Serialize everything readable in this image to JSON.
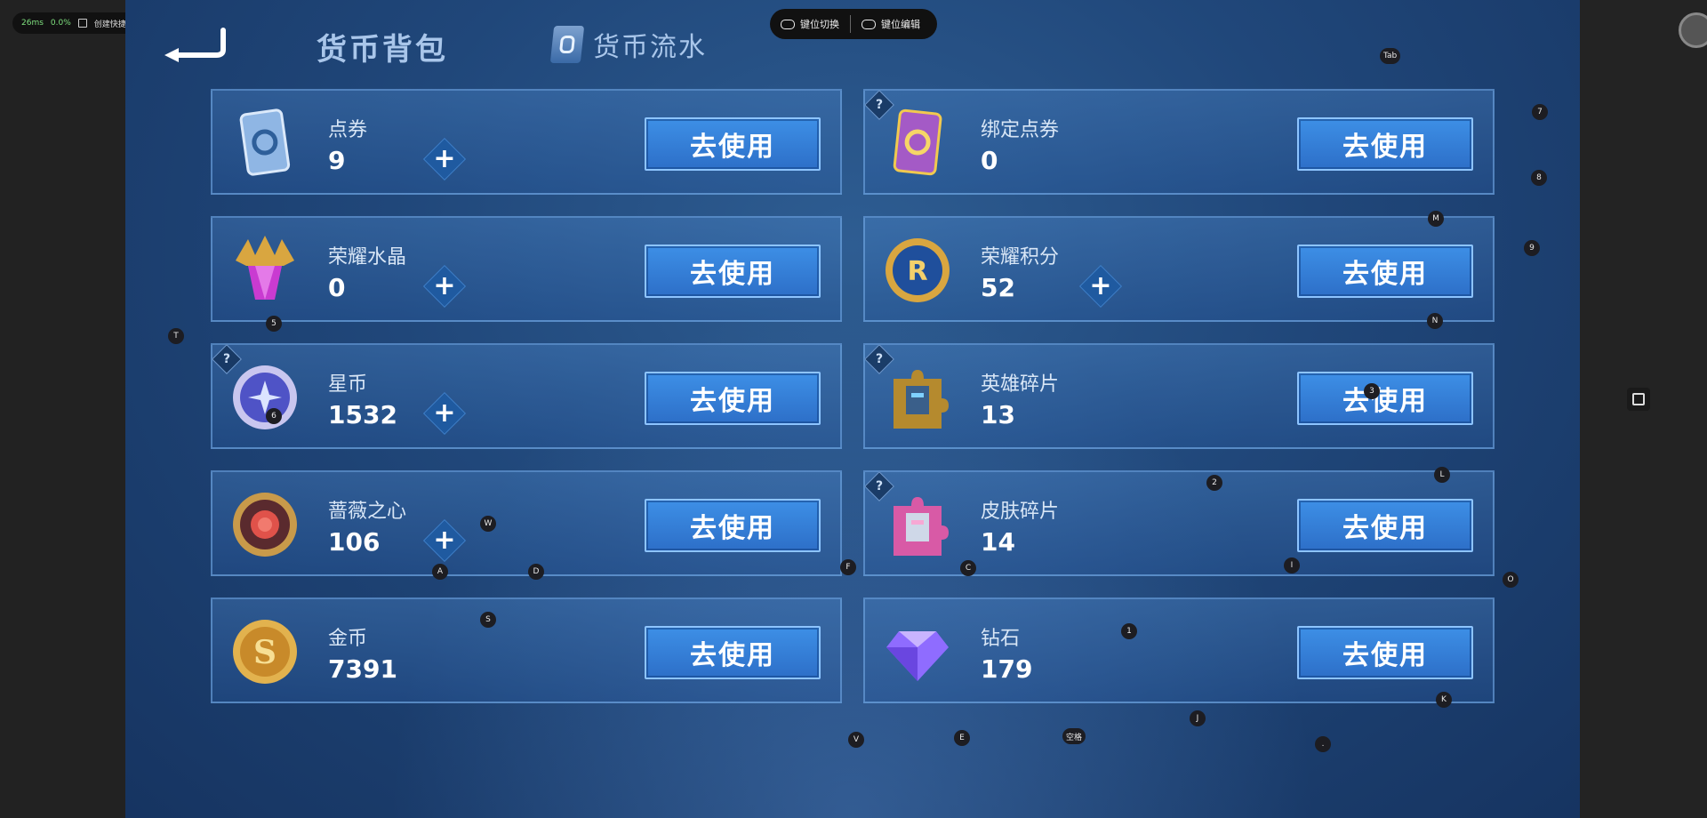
{
  "overlay": {
    "latency": "26ms",
    "loss": "0.0%",
    "shortcut_label": "创建快捷方式",
    "keymap_switch": "键位切换",
    "keymap_edit": "键位编辑"
  },
  "header": {
    "title": "货币背包",
    "flow_tab": "货币流水"
  },
  "colors": {
    "accent_blue": "#3d8fe6",
    "panel_border": "#78afeb",
    "background": "#20477a"
  },
  "cards": [
    {
      "name": "点券",
      "amount": "9",
      "button": "去使用",
      "icon": "voucher-icon"
    },
    {
      "name": "绑定点券",
      "amount": "0",
      "button": "去使用",
      "icon": "bound-voucher-icon"
    },
    {
      "name": "荣耀水晶",
      "amount": "0",
      "button": "去使用",
      "icon": "glory-crystal-icon"
    },
    {
      "name": "荣耀积分",
      "amount": "52",
      "button": "去使用",
      "icon": "glory-points-icon"
    },
    {
      "name": "星币",
      "amount": "1532",
      "button": "去使用",
      "icon": "star-coin-icon"
    },
    {
      "name": "英雄碎片",
      "amount": "13",
      "button": "去使用",
      "icon": "hero-fragment-icon"
    },
    {
      "name": "蔷薇之心",
      "amount": "106",
      "button": "去使用",
      "icon": "rose-heart-icon"
    },
    {
      "name": "皮肤碎片",
      "amount": "14",
      "button": "去使用",
      "icon": "skin-fragment-icon"
    },
    {
      "name": "金币",
      "amount": "7391",
      "button": "去使用",
      "icon": "gold-coin-icon"
    },
    {
      "name": "钻石",
      "amount": "179",
      "button": "去使用",
      "icon": "diamond-icon"
    }
  ],
  "plus_symbol": "+",
  "help_symbol": "?",
  "key_hints": [
    "Tab",
    "7",
    "8",
    "M",
    "9",
    "T",
    "5",
    "N",
    "6",
    "3",
    "2",
    "L",
    "W",
    "A",
    "D",
    "F",
    "C",
    "I",
    "O",
    "S",
    "1",
    "K",
    "J",
    "V",
    "E",
    "空格",
    "."
  ]
}
